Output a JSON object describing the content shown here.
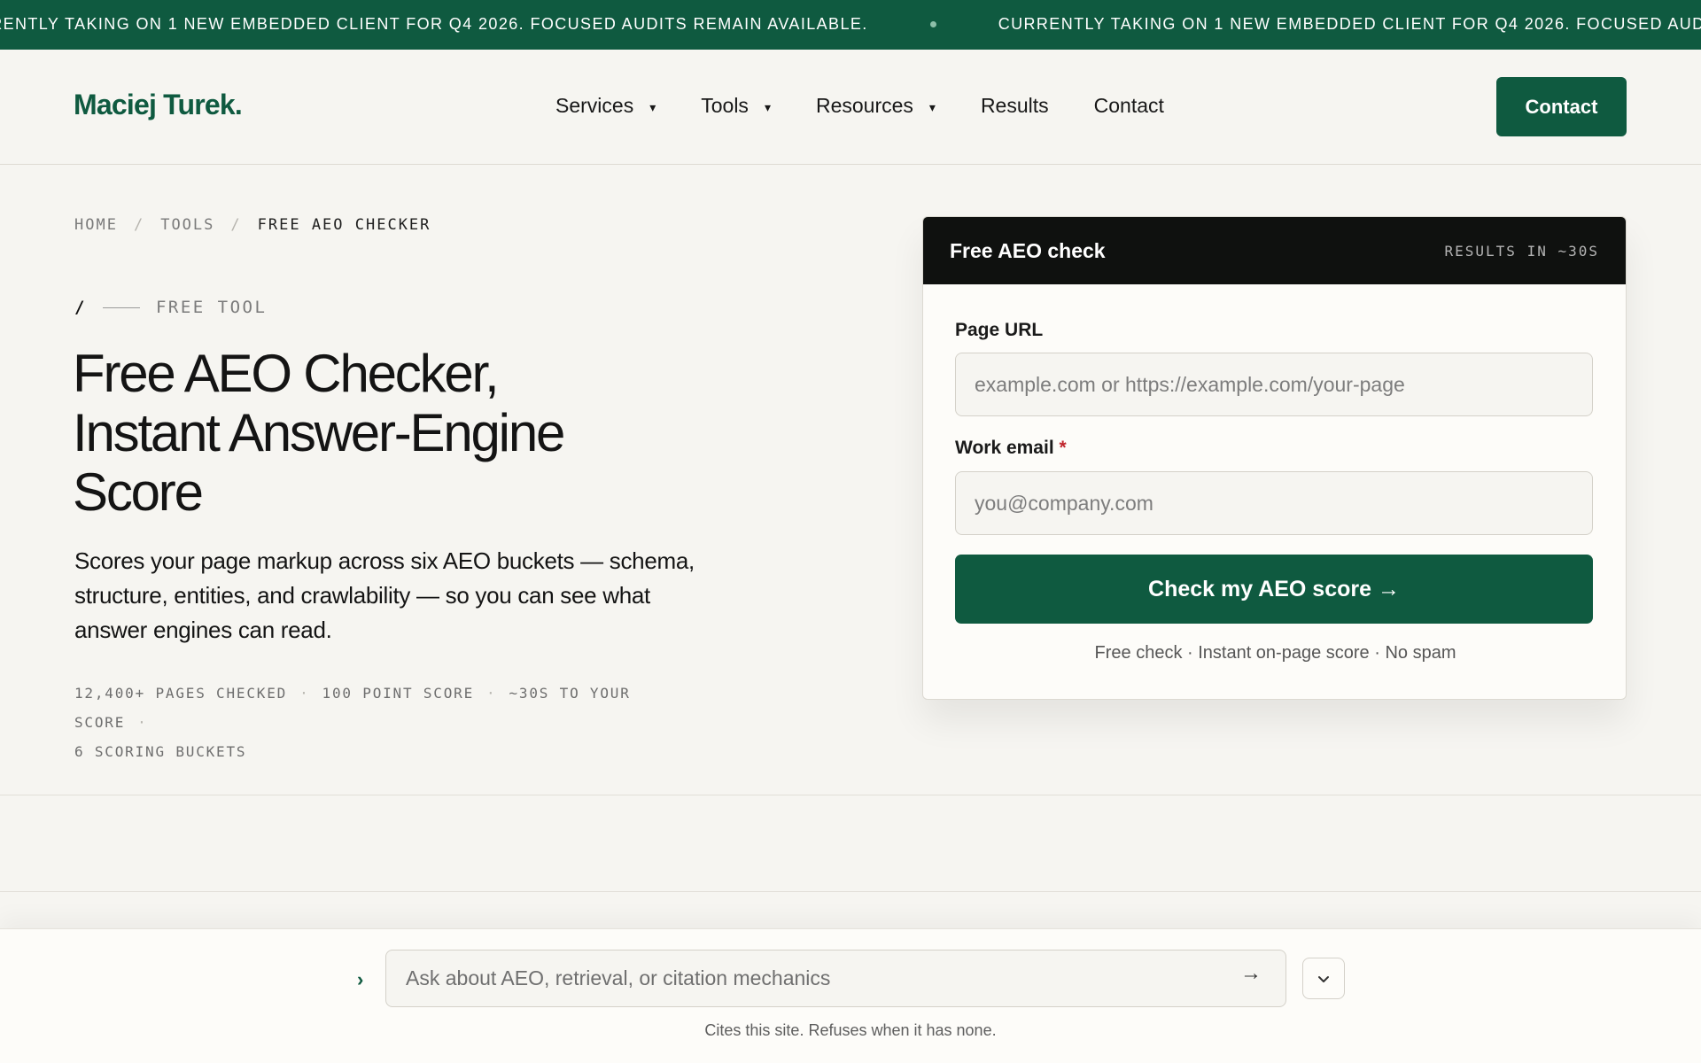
{
  "ticker": {
    "message": "CURRENTLY TAKING ON 1 NEW EMBEDDED CLIENT FOR Q4 2026. FOCUSED AUDITS REMAIN AVAILABLE."
  },
  "header": {
    "logo": "Maciej Turek.",
    "nav": [
      {
        "label": "Services",
        "has_dropdown": true
      },
      {
        "label": "Tools",
        "has_dropdown": true
      },
      {
        "label": "Resources",
        "has_dropdown": true
      },
      {
        "label": "Results",
        "has_dropdown": false
      },
      {
        "label": "Contact",
        "has_dropdown": false
      }
    ],
    "cta_label": "Contact",
    "caret_glyph": "▾"
  },
  "breadcrumb": {
    "items": [
      "HOME",
      "TOOLS",
      "FREE AEO CHECKER"
    ],
    "separator": "/"
  },
  "hero": {
    "eyebrow_slash": "/",
    "eyebrow": "FREE TOOL",
    "title": "Free AEO Checker, Instant Answer-Engine Score",
    "lede": "Scores your page markup across six AEO buckets — schema, structure, entities, and crawlability — so you can see what answer engines can read.",
    "stats": [
      "12,400+ PAGES CHECKED",
      "100 POINT SCORE",
      "~30S TO YOUR SCORE",
      "6 SCORING BUCKETS"
    ],
    "stats_separator": "·"
  },
  "form": {
    "title": "Free AEO check",
    "meta": "RESULTS IN ~30S",
    "url_label": "Page URL",
    "url_placeholder": "example.com or https://example.com/your-page",
    "url_value": "",
    "email_label": "Work email",
    "email_required_mark": "*",
    "email_placeholder": "you@company.com",
    "email_value": "",
    "submit_label": "Check my AEO score →",
    "note": "Free check · Instant on-page score · No spam"
  },
  "chat": {
    "prompt_glyph": "›",
    "placeholder": "Ask about AEO, retrieval, or citation mechanics",
    "send_glyph": "→",
    "note": "Cites this site. Refuses when it has none."
  },
  "colors": {
    "brand_green": "#0f5a40",
    "dark_header": "#0f110f",
    "page_bg": "#f6f5f1",
    "required_red": "#c0262d"
  }
}
